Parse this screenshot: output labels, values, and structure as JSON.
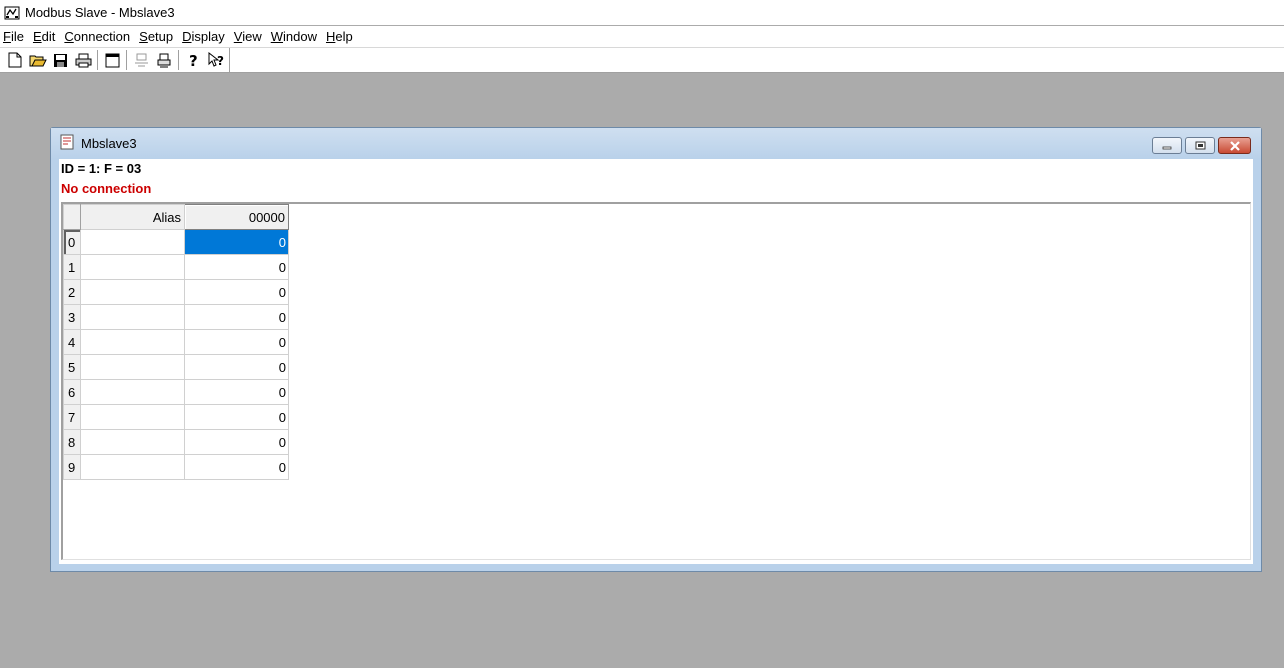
{
  "app": {
    "title": "Modbus Slave - Mbslave3"
  },
  "menu": [
    {
      "underline": "F",
      "rest": "ile"
    },
    {
      "underline": "E",
      "rest": "dit"
    },
    {
      "underline": "C",
      "rest": "onnection"
    },
    {
      "underline": "S",
      "rest": "etup"
    },
    {
      "underline": "D",
      "rest": "isplay"
    },
    {
      "underline": "V",
      "rest": "iew"
    },
    {
      "underline": "W",
      "rest": "indow"
    },
    {
      "underline": "H",
      "rest": "elp"
    }
  ],
  "toolbar": {
    "icons": [
      "new-file-icon",
      "open-folder-icon",
      "save-icon",
      "print-icon",
      "window-icon",
      "connect-icon",
      "print-preview-icon",
      "help-icon",
      "context-help-icon"
    ]
  },
  "child": {
    "title": "Mbslave3",
    "info_line": "ID = 1: F = 03",
    "status": "No connection",
    "columns": {
      "alias": "Alias",
      "address": "00000"
    },
    "rows": [
      {
        "index": "0",
        "alias": "",
        "value": "0"
      },
      {
        "index": "1",
        "alias": "",
        "value": "0"
      },
      {
        "index": "2",
        "alias": "",
        "value": "0"
      },
      {
        "index": "3",
        "alias": "",
        "value": "0"
      },
      {
        "index": "4",
        "alias": "",
        "value": "0"
      },
      {
        "index": "5",
        "alias": "",
        "value": "0"
      },
      {
        "index": "6",
        "alias": "",
        "value": "0"
      },
      {
        "index": "7",
        "alias": "",
        "value": "0"
      },
      {
        "index": "8",
        "alias": "",
        "value": "0"
      },
      {
        "index": "9",
        "alias": "",
        "value": "0"
      }
    ],
    "selected_row": 0
  },
  "colors": {
    "workspace": "#ababab",
    "selection": "#0078d7",
    "status_error": "#cc0000"
  }
}
